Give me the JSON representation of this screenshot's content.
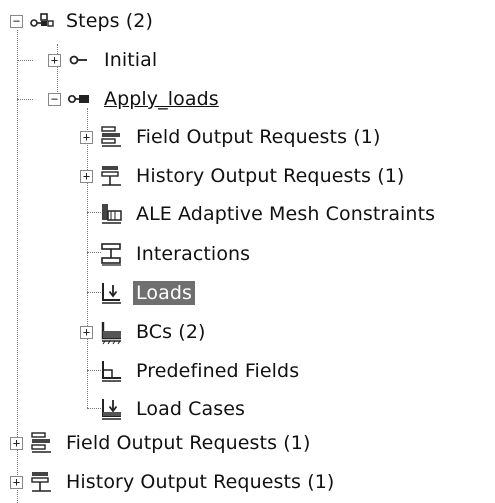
{
  "tree": {
    "steps": {
      "label": "Steps (2)",
      "icon": "steps-icon"
    },
    "initial": {
      "label": "Initial",
      "icon": "initial-step-icon"
    },
    "apply_loads": {
      "label": "Apply_loads",
      "icon": "apply-loads-step-icon"
    },
    "field_output_requests": {
      "label": "Field Output Requests (1)",
      "icon": "field-output-icon"
    },
    "history_output_requests": {
      "label": "History Output Requests (1)",
      "icon": "history-output-icon"
    },
    "ale_constraints": {
      "label": "ALE Adaptive Mesh Constraints",
      "icon": "ale-constraints-icon"
    },
    "interactions": {
      "label": "Interactions",
      "icon": "interactions-icon"
    },
    "loads": {
      "label": "Loads",
      "icon": "loads-icon"
    },
    "bcs": {
      "label": "BCs (2)",
      "icon": "bcs-icon"
    },
    "predefined_fields": {
      "label": "Predefined Fields",
      "icon": "predefined-fields-icon"
    },
    "load_cases": {
      "label": "Load Cases",
      "icon": "load-cases-icon"
    },
    "root_field_output_requests": {
      "label": "Field Output Requests (1)",
      "icon": "field-output-icon"
    },
    "root_history_output_requests": {
      "label": "History Output Requests (1)",
      "icon": "history-output-icon"
    }
  },
  "expander_symbols": {
    "collapsed": "+",
    "expanded": "−"
  },
  "selected_color": "#6f6f6f"
}
